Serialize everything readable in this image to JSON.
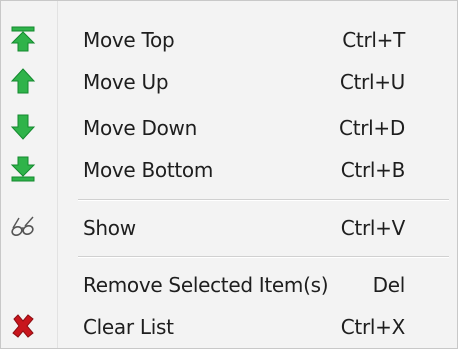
{
  "menu": {
    "items": [
      {
        "label": "Move Top",
        "shortcut": "Ctrl+T",
        "icon": "move-top-arrow-icon"
      },
      {
        "label": "Move Up",
        "shortcut": "Ctrl+U",
        "icon": "move-up-arrow-icon"
      },
      {
        "label": "Move Down",
        "shortcut": "Ctrl+D",
        "icon": "move-down-arrow-icon"
      },
      {
        "label": "Move Bottom",
        "shortcut": "Ctrl+B",
        "icon": "move-bottom-arrow-icon"
      },
      {
        "label": "Show",
        "shortcut": "Ctrl+V",
        "icon": "glasses-icon"
      },
      {
        "label": "Remove Selected Item(s)",
        "shortcut": "Del",
        "icon": ""
      },
      {
        "label": "Clear List",
        "shortcut": "Ctrl+X",
        "icon": "red-x-icon"
      }
    ]
  },
  "colors": {
    "arrow_green": "#2fb34a",
    "arrow_green_dark": "#138a2e",
    "clear_red": "#c8161d",
    "menu_bg": "#f3f3f3"
  }
}
